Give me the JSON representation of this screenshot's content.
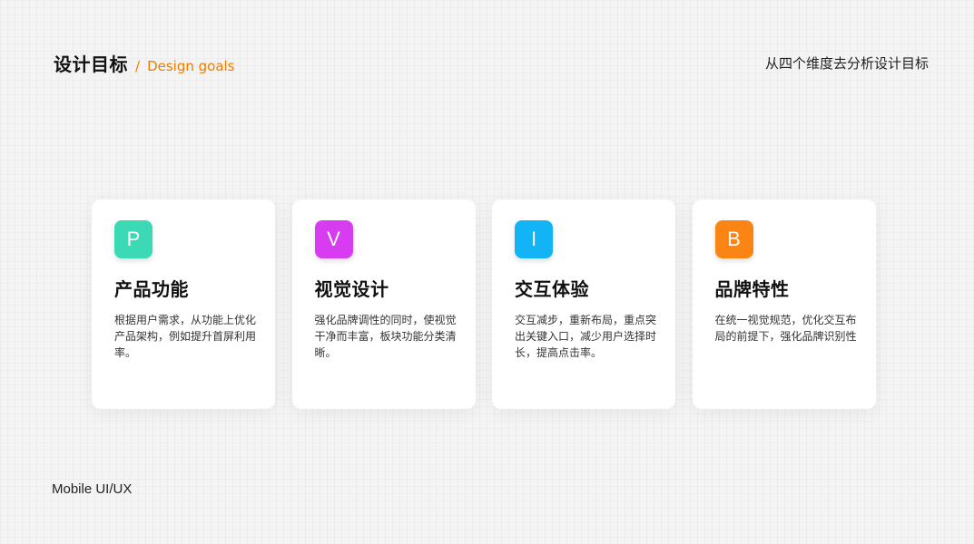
{
  "header": {
    "title": "设计目标",
    "separator": "/",
    "subtitle": "Design goals",
    "right_text": "从四个维度去分析设计目标"
  },
  "colors": {
    "accent": "#f07c00"
  },
  "cards": [
    {
      "badge": "P",
      "badge_color": "#3bd9b4",
      "title": "产品功能",
      "description": "根据用户需求，从功能上优化产品架构，例如提升首屏利用率。"
    },
    {
      "badge": "V",
      "badge_color": "#d83cf0",
      "title": "视觉设计",
      "description": "强化品牌调性的同时，使视觉干净而丰富，板块功能分类清晰。"
    },
    {
      "badge": "I",
      "badge_color": "#13b4f5",
      "title": "交互体验",
      "description": "交互减步，重新布局，重点突出关键入口，减少用户选择时长，提高点击率。"
    },
    {
      "badge": "B",
      "badge_color": "#fa8514",
      "title": "品牌特性",
      "description": "在统一视觉规范，优化交互布局的前提下，强化品牌识别性"
    }
  ],
  "footer": {
    "text": "Mobile UI/UX"
  }
}
